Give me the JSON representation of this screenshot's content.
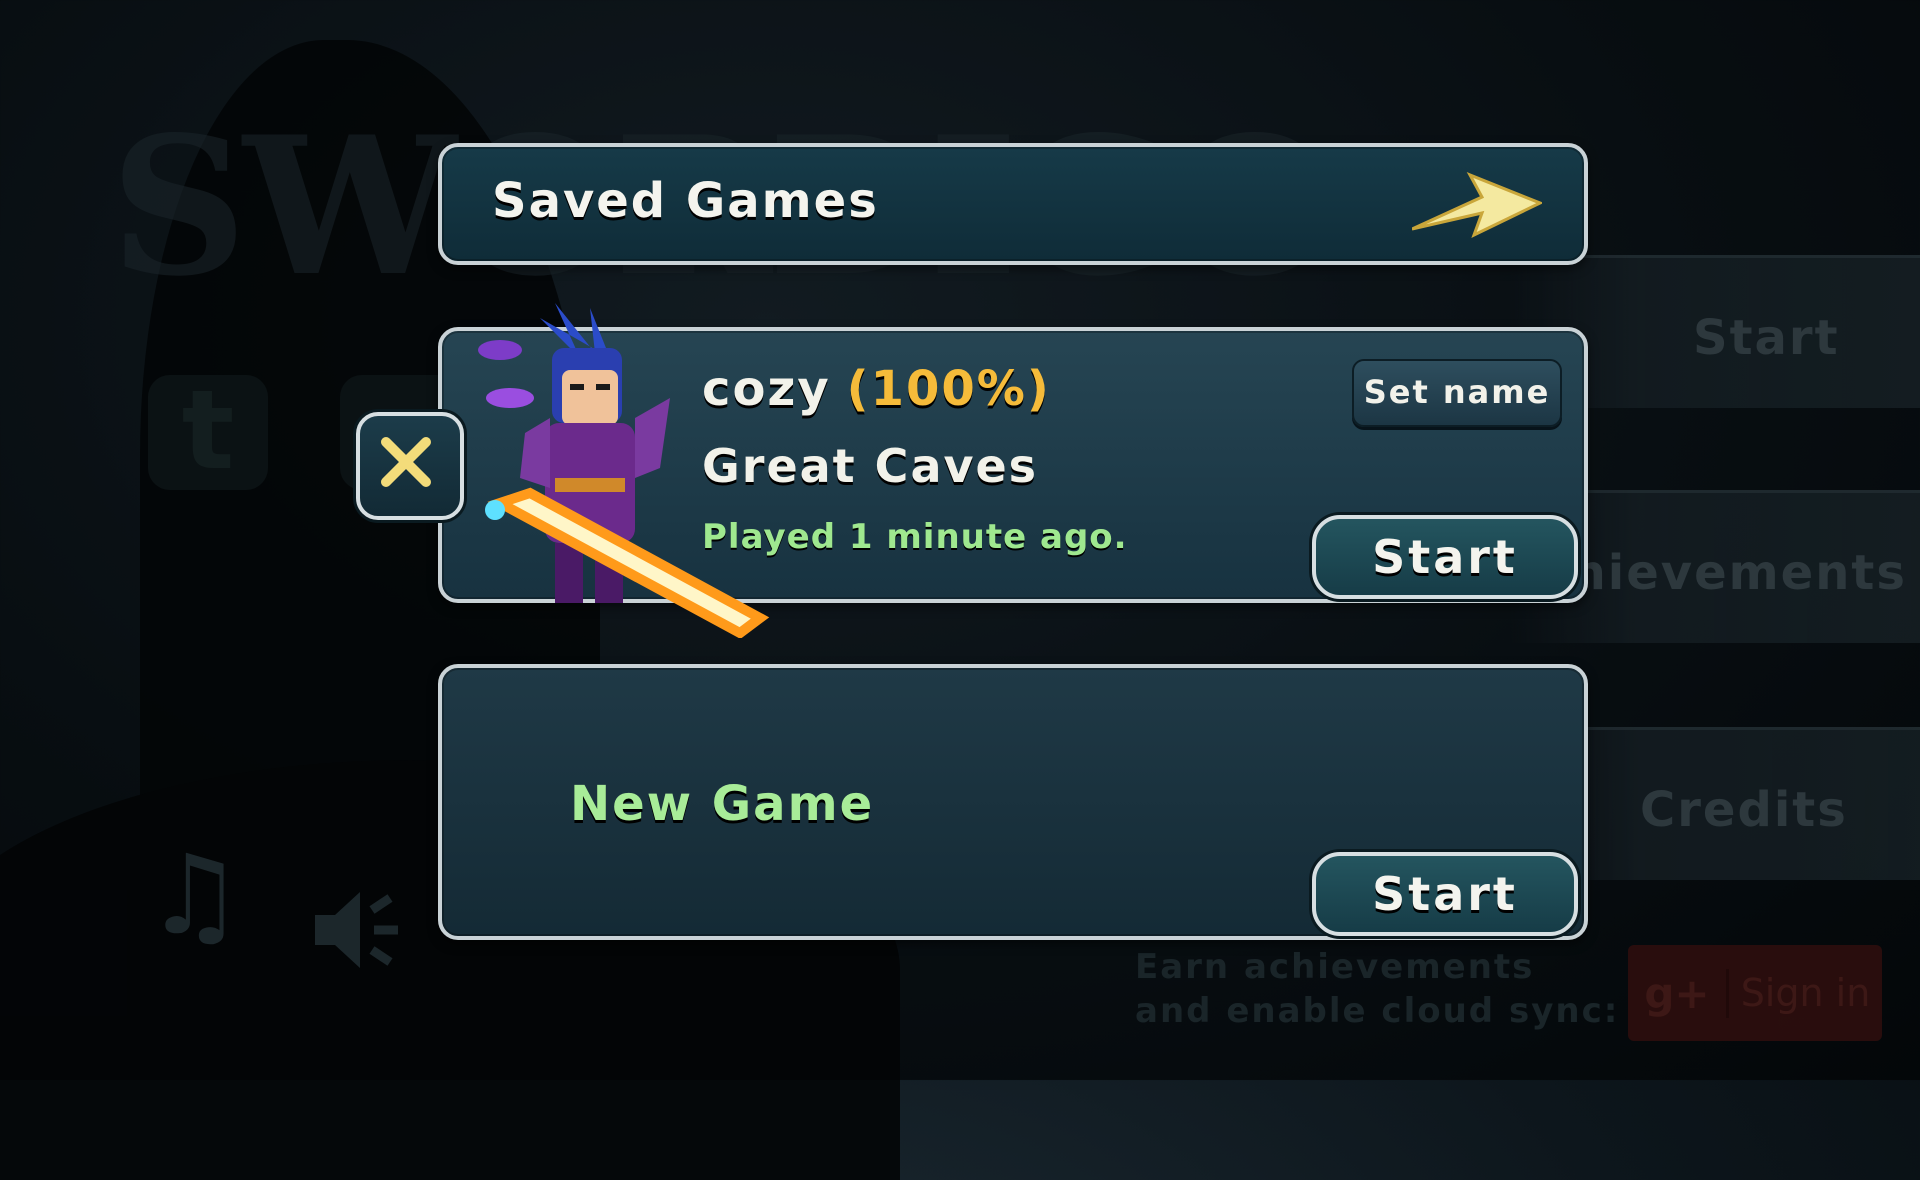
{
  "background": {
    "logo_text": "SWORDIGO",
    "menu_items": [
      "Start",
      "Achievements",
      "Credits"
    ],
    "sync_text_line1": "Earn achievements",
    "sync_text_line2": "and enable cloud sync:",
    "signin_label": "Sign in",
    "gplus_label": "g+",
    "social_twitter": "t",
    "icons": [
      "music-note-icon",
      "speaker-icon",
      "twitter-icon",
      "google-plus-icon"
    ]
  },
  "header": {
    "title": "Saved Games",
    "arrow_icon": "arrow-right-icon"
  },
  "save_slot": {
    "name": "cozy",
    "progress": "(100%)",
    "location": "Great Caves",
    "played": "Played 1 minute ago.",
    "set_name_label": "Set name",
    "start_label": "Start",
    "delete_icon": "close-x-icon"
  },
  "new_slot": {
    "label": "New Game",
    "start_label": "Start"
  },
  "colors": {
    "accent_gold": "#f5bb3a",
    "played_green": "#9fe88f",
    "new_game_green": "#a8ec98",
    "panel_border": "#c9d2d6"
  }
}
